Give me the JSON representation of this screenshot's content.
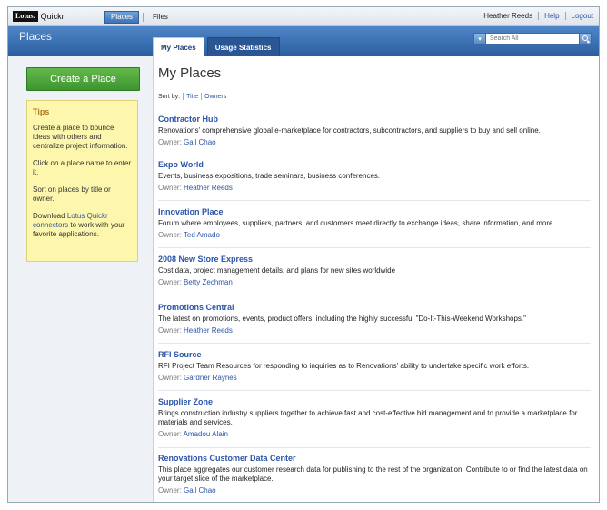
{
  "topbar": {
    "brand_logo": "Lotus.",
    "brand_name": "Quickr",
    "app_tabs": [
      "Places",
      "Files"
    ],
    "user_name": "Heather Reeds",
    "links": [
      "Help",
      "Logout"
    ]
  },
  "header": {
    "title": "Places",
    "tabs": [
      "My Places",
      "Usage Statistics"
    ],
    "search_placeholder": "Search All"
  },
  "sidebar": {
    "create_label": "Create a Place",
    "tips_title": "Tips",
    "tip1": "Create a place to bounce ideas with others and centralize project information.",
    "tip2": "Click on a place name to enter it.",
    "tip3": "Sort on places by title or owner.",
    "tip4_pre": "Download",
    "tip4_link": "Lotus Quickr connectors",
    "tip4_post": "to work with your favorite applications."
  },
  "main": {
    "title": "My Places",
    "sort_label": "Sort by:",
    "sort_options": [
      "Title",
      "Owners"
    ],
    "owner_label": "Owner:",
    "places": [
      {
        "name": "Contractor Hub",
        "desc": "Renovations' comprehensive global e-marketplace for contractors, subcontractors, and suppliers to buy and sell online.",
        "owner": "Gail Chao"
      },
      {
        "name": "Expo World",
        "desc": "Events, business expositions, trade seminars, business conferences.",
        "owner": "Heather Reeds"
      },
      {
        "name": "Innovation Place",
        "desc": "Forum where employees, suppliers, partners, and customers meet directly to exchange ideas, share information, and more.",
        "owner": "Ted Amado"
      },
      {
        "name": "2008 New Store Express",
        "desc": "Cost data, project management details, and plans for new sites worldwide",
        "owner": "Betty Zechman"
      },
      {
        "name": "Promotions Central",
        "desc": "The latest on promotions, events, product offers, including the highly successful \"Do-It-This-Weekend Workshops.\"",
        "owner": "Heather Reeds"
      },
      {
        "name": "RFI Source",
        "desc": "RFI Project Team Resources for responding to inquiries as to Renovations' ability to undertake specific work efforts.",
        "owner": "Gardner Raynes"
      },
      {
        "name": "Supplier Zone",
        "desc": "Brings construction industry suppliers together to achieve fast and cost-effective bid management and to provide a marketplace for materials and services.",
        "owner": "Amadou Alain"
      },
      {
        "name": "Renovations Customer Data Center",
        "desc": "This place aggregates our customer research data for publishing to the rest of the organization. Contribute to or find the latest data on your target slice of the marketplace.",
        "owner": "Gail Chao"
      }
    ]
  }
}
